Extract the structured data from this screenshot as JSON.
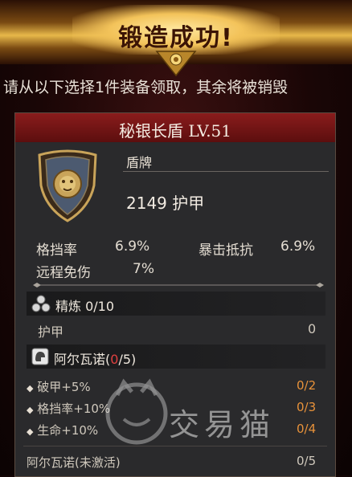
{
  "banner": {
    "title": "锻造成功!"
  },
  "subtitle": "请从以下选择1件装备领取，其余将被销毁",
  "item": {
    "name": "秘银长盾 LV.51",
    "type": "盾牌",
    "main_stat": "2149 护甲",
    "icon": "lion-shield-icon"
  },
  "stats": [
    {
      "label": "格挡率",
      "value": "6.9%"
    },
    {
      "label": "暴击抵抗",
      "value": "6.9%"
    },
    {
      "label": "远程免伤",
      "value": "7%"
    }
  ],
  "refine": {
    "label": "精炼 0/10",
    "rows": [
      {
        "label": "护甲",
        "value": "0"
      }
    ]
  },
  "set": {
    "name": "阿尔瓦诺",
    "open": "(",
    "count_zero": "0",
    "count_rest": "/5)",
    "bonuses": [
      {
        "label": "破甲+5%",
        "value": "0/2"
      },
      {
        "label": "格挡率+10%",
        "value": "0/3"
      },
      {
        "label": "生命+10%",
        "value": "0/4"
      }
    ],
    "inactive_label": "阿尔瓦诺(未激活)",
    "inactive_value": "0/5"
  },
  "watermark": "交易猫",
  "colors": {
    "header_red": "#8a1c1c",
    "gold": "#e7b84a",
    "set_count_red": "#e04040",
    "bonus_orange": "#e8923a"
  }
}
